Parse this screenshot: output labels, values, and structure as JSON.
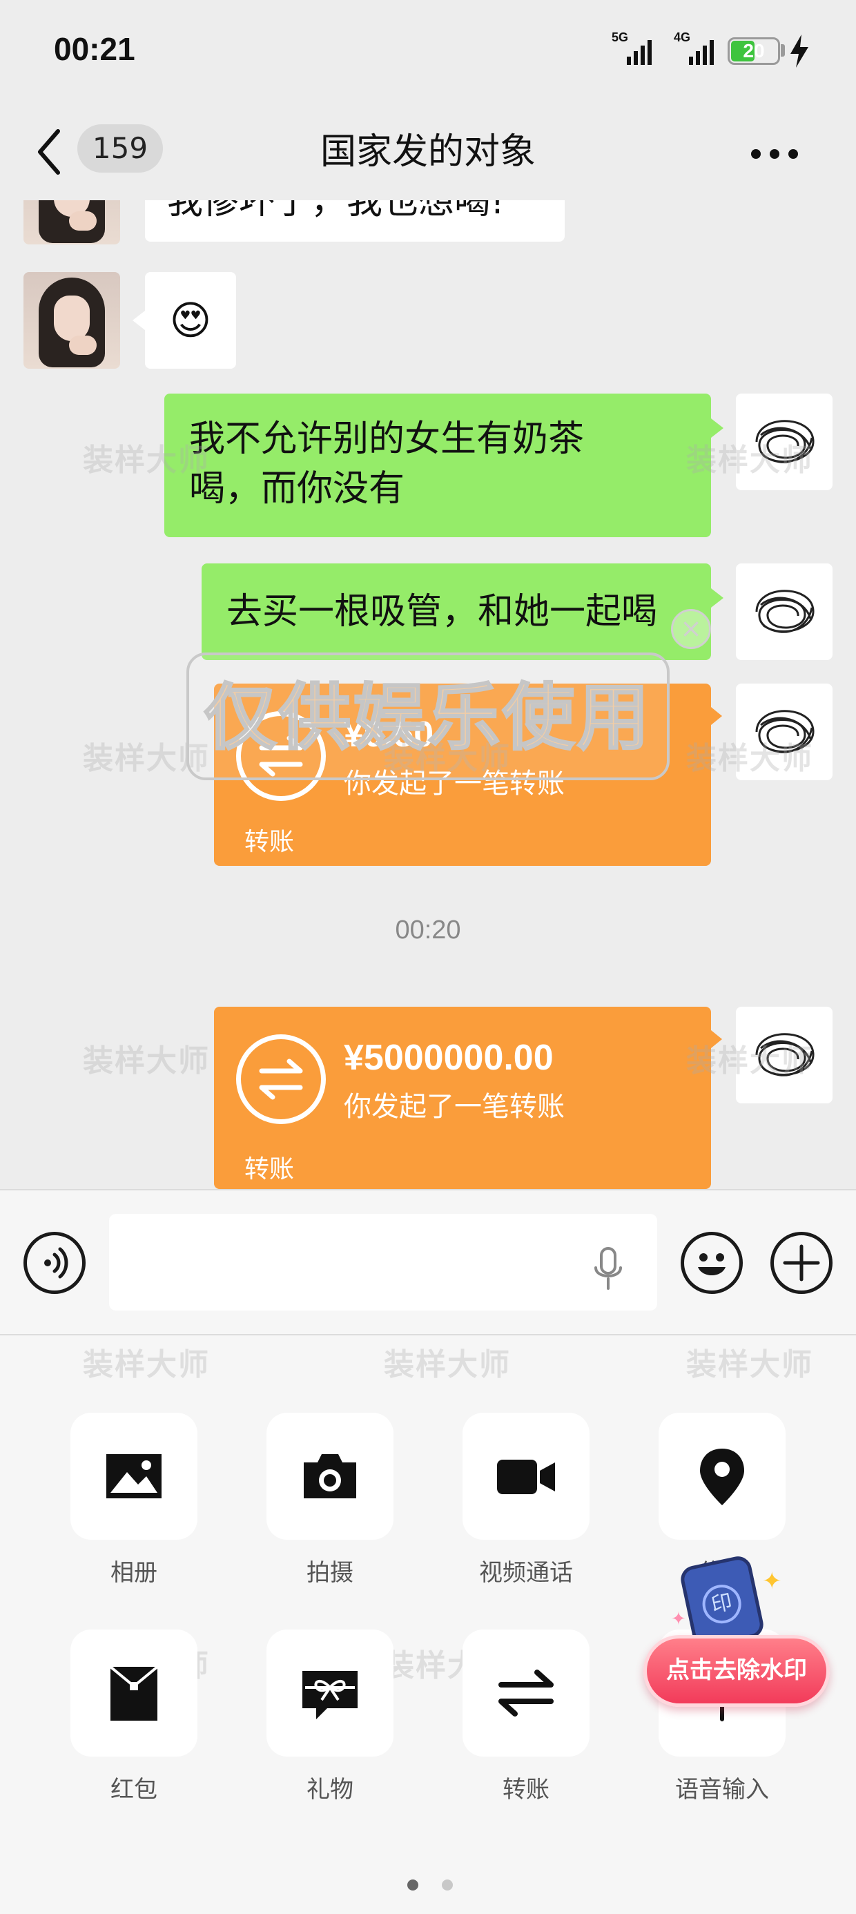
{
  "status_bar": {
    "time": "00:21",
    "network_1": "5G",
    "network_2": "4G",
    "battery": "20"
  },
  "header": {
    "unread_count": "159",
    "title": "国家发的对象",
    "back_icon": "chevron-left-icon",
    "more_icon": "more-dots-icon"
  },
  "messages": {
    "partial_text": "我惨坏了，我也想喝!",
    "emoji": "😍",
    "msg1": "我不允许别的女生有奶茶喝，而你没有",
    "msg1_line1": "我不允许别的女生有奶茶",
    "msg1_line2": "喝，而你没有",
    "msg2": "去买一根吸管，和她一起喝",
    "transfer1": {
      "amount": "¥0.50",
      "desc": "你发起了一笔转账",
      "label": "转账"
    },
    "time_separator": "00:20",
    "transfer2": {
      "amount": "¥5000000.00",
      "desc": "你发起了一笔转账",
      "label": "转账"
    }
  },
  "overlay": {
    "text": "仅供娱乐使用",
    "watermark": "装样大师"
  },
  "input_bar": {
    "value": "",
    "voice_icon": "voice-mode-icon",
    "mic_icon": "microphone-icon",
    "emoji_icon": "emoji-icon",
    "plus_icon": "plus-icon"
  },
  "panel": {
    "items": [
      {
        "label": "相册",
        "icon": "album-icon"
      },
      {
        "label": "拍摄",
        "icon": "camera-icon"
      },
      {
        "label": "视频通话",
        "icon": "video-call-icon"
      },
      {
        "label": "位置",
        "icon": "location-icon"
      },
      {
        "label": "红包",
        "icon": "red-packet-icon"
      },
      {
        "label": "礼物",
        "icon": "gift-icon"
      },
      {
        "label": "转账",
        "icon": "transfer-icon"
      },
      {
        "label": "语音输入",
        "icon": "voice-input-icon"
      }
    ],
    "page": 1,
    "pages": 2
  },
  "promo": {
    "label": "点击去除水印",
    "badge": "印"
  },
  "colors": {
    "green_bubble": "#95ec69",
    "transfer": "#fa9d3b",
    "background": "#ededed"
  }
}
